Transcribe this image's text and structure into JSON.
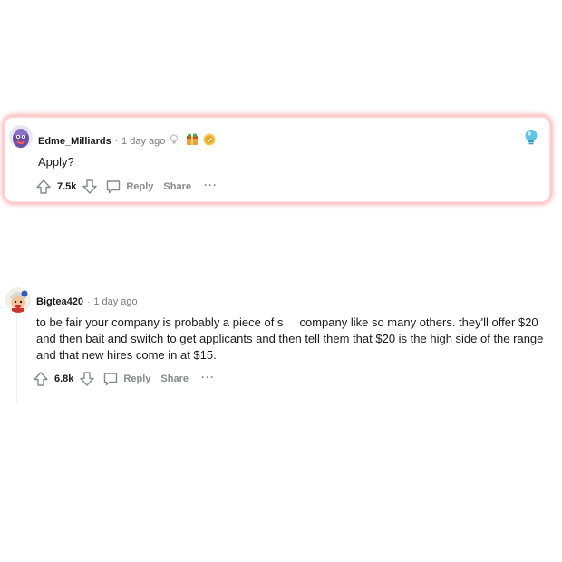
{
  "comments": [
    {
      "username": "Edme_Milliards",
      "separator": "·",
      "time": "1 day ago",
      "body": "Apply?",
      "score": "7.5k",
      "reply_label": "Reply",
      "share_label": "Share",
      "more_label": "···",
      "highlight_color": "#ff9a9a"
    },
    {
      "username": "Bigtea420",
      "separator": "·",
      "time": "1 day ago",
      "body": "to be fair your company is probably a piece of s     company like so many others. they'll offer $20 and then bait and switch to get applicants and then tell them that $20 is the high side of the range and that new hires come in at $15.",
      "score": "6.8k",
      "reply_label": "Reply",
      "share_label": "Share",
      "more_label": "···"
    }
  ],
  "colors": {
    "meta_gray": "#878a8c",
    "text": "#1a1a1b",
    "bulb_blue": "#5fc3e4"
  },
  "icons": [
    "upvote-icon",
    "downvote-icon",
    "reply-icon",
    "bulb-icon",
    "award-icon",
    "award-icon",
    "bulb-icon"
  ]
}
